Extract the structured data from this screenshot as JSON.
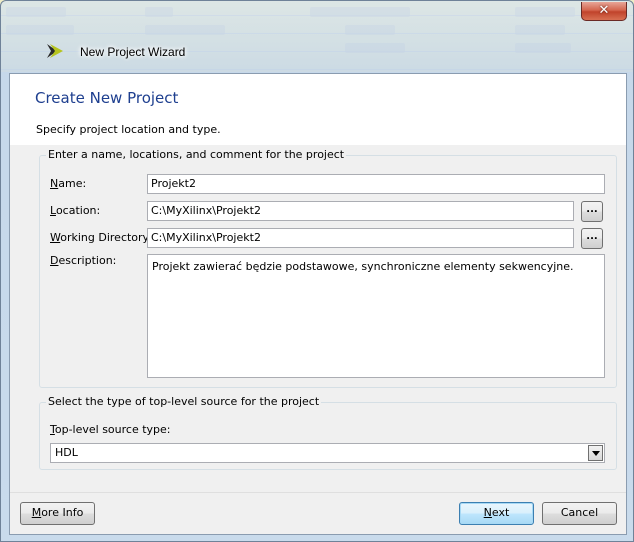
{
  "window": {
    "title": "New Project Wizard",
    "close_symbol": "✕",
    "icon": "xilinx-logo-icon"
  },
  "header": {
    "page_title": "Create New Project",
    "instruction": "Specify project location and type."
  },
  "project_group": {
    "legend": "Enter a name, locations, and comment for the project",
    "name": {
      "label_mnemonic": "N",
      "label_rest": "ame:",
      "value": "Projekt2"
    },
    "location": {
      "label_mnemonic": "L",
      "label_rest": "ocation:",
      "value": "C:\\MyXilinx\\Projekt2",
      "browse_label": "..."
    },
    "working_directory": {
      "label_mnemonic": "W",
      "label_rest": "orking Directory:",
      "value": "C:\\MyXilinx\\Projekt2",
      "browse_label": "..."
    },
    "description": {
      "label_mnemonic": "D",
      "label_rest": "escription:",
      "value": "Projekt zawierać będzie podstawowe, synchroniczne elementy sekwencyjne."
    }
  },
  "source_group": {
    "legend": "Select the type of top-level source for the project",
    "top_level": {
      "label_mnemonic": "T",
      "label_rest": "op-level source type:",
      "selected": "HDL"
    }
  },
  "footer": {
    "more_info": {
      "mnemonic": "M",
      "rest": "ore Info"
    },
    "next": {
      "mnemonic": "N",
      "rest": "ext"
    },
    "cancel": "Cancel"
  },
  "colors": {
    "title_blue": "#1e3f8f",
    "default_button_border": "#3c7fb1",
    "close_button_red": "#c0432b"
  }
}
